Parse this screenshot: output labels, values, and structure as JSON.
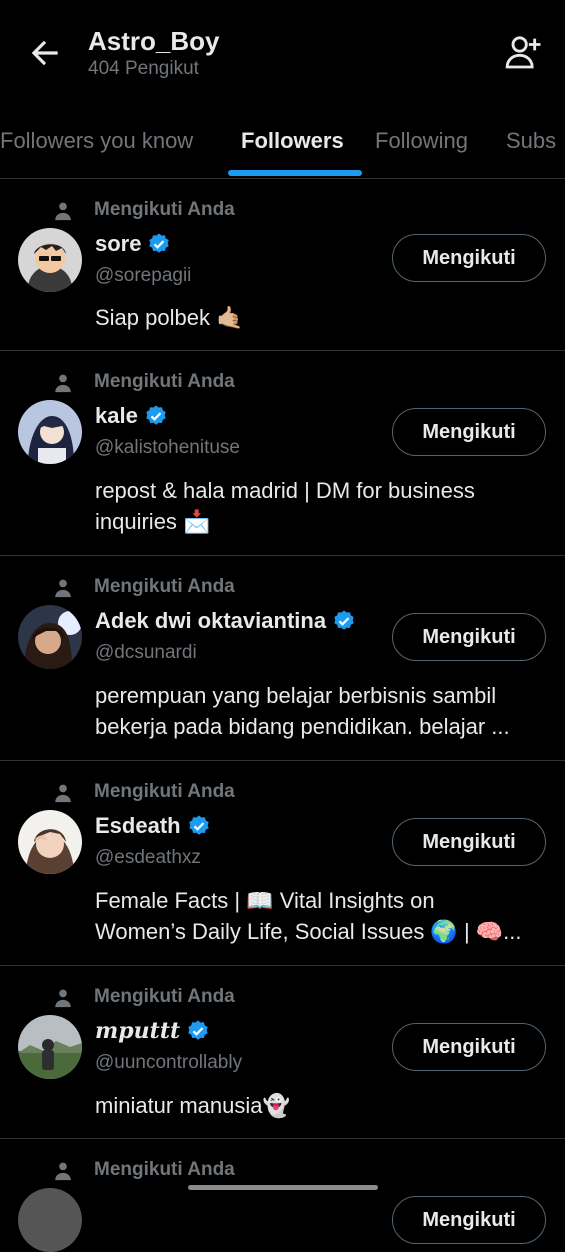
{
  "header": {
    "title": "Astro_Boy",
    "subtitle": "404 Pengikut"
  },
  "tabs": [
    {
      "label": "Followers you know"
    },
    {
      "label": "Followers"
    },
    {
      "label": "Following"
    },
    {
      "label": "Subs"
    }
  ],
  "context_label": "Mengikuti Anda",
  "follow_label": "Mengikuti",
  "users": [
    {
      "name": "sore",
      "handle": "@sorepagii",
      "bio": [
        "Siap polbek 🤙🏼"
      ]
    },
    {
      "name": "kale",
      "handle": "@kalistohenituse",
      "bio": [
        "repost & hala madrid | DM for business",
        "inquiries 📩"
      ]
    },
    {
      "name": "Adek dwi oktaviantina",
      "handle": "@dcsunardi",
      "bio": [
        "perempuan yang belajar berbisnis sambil",
        "bekerja pada bidang pendidikan. belajar ..."
      ]
    },
    {
      "name": "Esdeath",
      "handle": "@esdeathxz",
      "bio": [
        "Female Facts | 📖 Vital Insights on",
        "Women’s Daily Life, Social Issues 🌍 | 🧠..."
      ]
    },
    {
      "name": "mputtt",
      "handle": "@uuncontrollably",
      "bio": [
        "miniatur manusia👻"
      ]
    },
    {
      "name": "",
      "handle": "",
      "bio": []
    }
  ],
  "colors": {
    "accent": "#1d9bf0",
    "background": "#000000",
    "secondary_text": "#71767b"
  }
}
